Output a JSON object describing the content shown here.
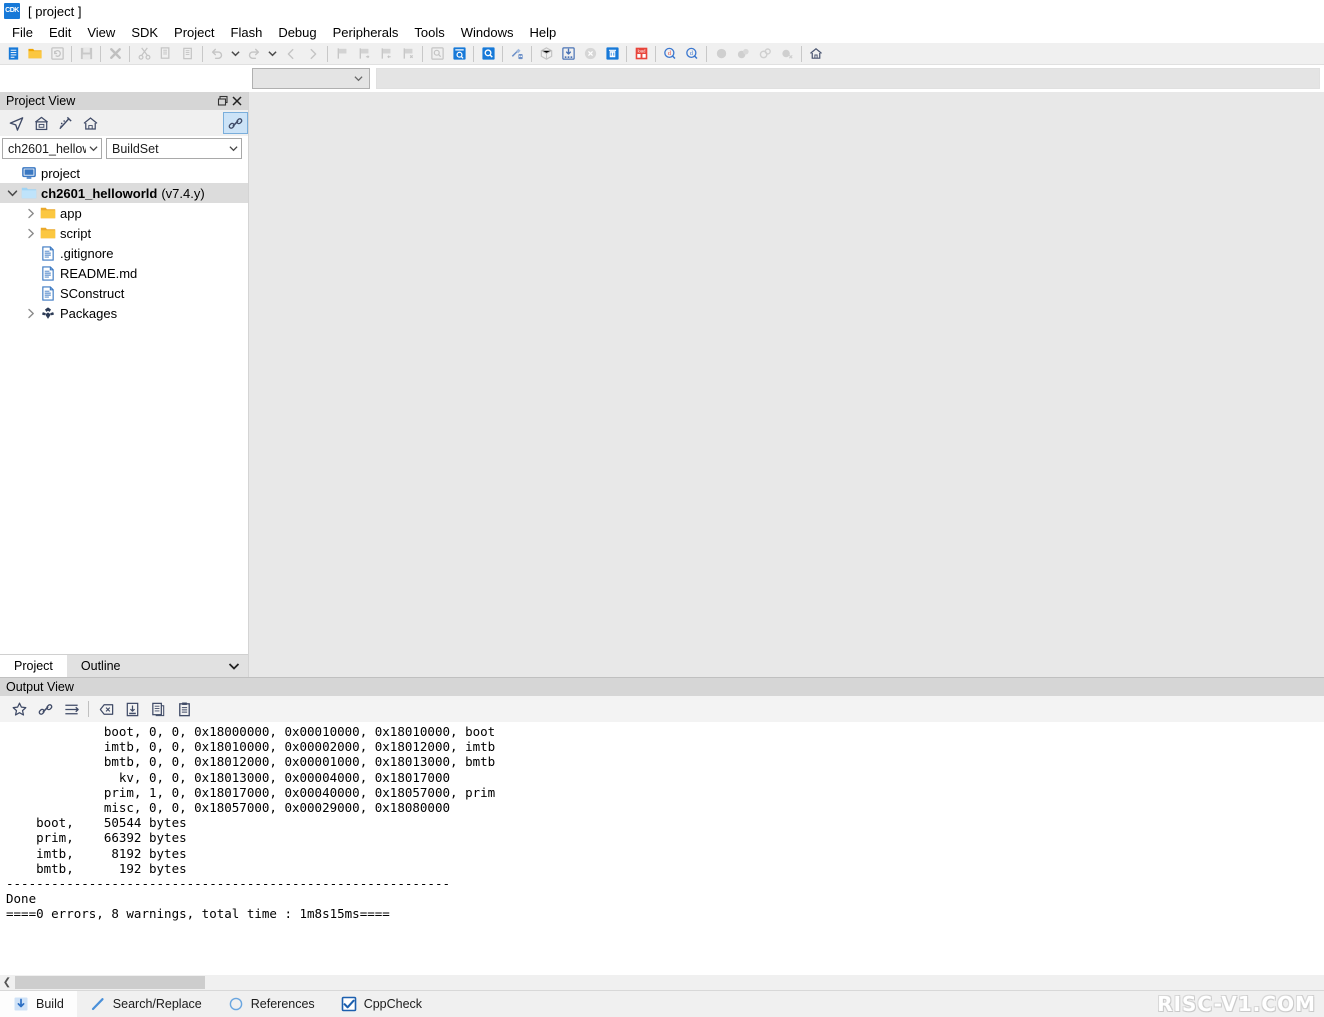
{
  "window": {
    "title": "[ project ]",
    "logo_text": "CDK"
  },
  "menubar": {
    "items": [
      {
        "label": "File"
      },
      {
        "label": "Edit"
      },
      {
        "label": "View"
      },
      {
        "label": "SDK"
      },
      {
        "label": "Project"
      },
      {
        "label": "Flash"
      },
      {
        "label": "Debug"
      },
      {
        "label": "Peripherals"
      },
      {
        "label": "Tools"
      },
      {
        "label": "Windows"
      },
      {
        "label": "Help"
      }
    ]
  },
  "toolbar": {
    "buttons": [
      {
        "name": "new-file-icon",
        "enabled": true
      },
      {
        "name": "open-folder-icon",
        "enabled": true
      },
      {
        "name": "refresh-icon",
        "enabled": false
      },
      {
        "name": "save-icon",
        "enabled": false
      },
      {
        "name": "close-all-icon",
        "enabled": false
      },
      {
        "name": "cut-icon",
        "enabled": false
      },
      {
        "name": "copy-icon",
        "enabled": false
      },
      {
        "name": "paste-icon",
        "enabled": false
      },
      {
        "name": "undo-icon",
        "enabled": false
      },
      {
        "name": "undo-dropdown-icon",
        "enabled": false
      },
      {
        "name": "redo-icon",
        "enabled": false
      },
      {
        "name": "redo-dropdown-icon",
        "enabled": false
      },
      {
        "name": "navigate-back-icon",
        "enabled": false
      },
      {
        "name": "navigate-forward-icon",
        "enabled": false
      },
      {
        "name": "bookmark-icon",
        "enabled": false
      },
      {
        "name": "bookmark-next-icon",
        "enabled": false
      },
      {
        "name": "bookmark-prev-icon",
        "enabled": false
      },
      {
        "name": "bookmark-clear-icon",
        "enabled": false
      },
      {
        "name": "find-icon",
        "enabled": false
      },
      {
        "name": "find-in-files-icon",
        "enabled": true
      },
      {
        "name": "search-icon",
        "enabled": true
      },
      {
        "name": "build-icon",
        "enabled": true
      },
      {
        "name": "package-icon",
        "enabled": false
      },
      {
        "name": "download-flash-icon",
        "enabled": true
      },
      {
        "name": "stop-build-icon",
        "enabled": false
      },
      {
        "name": "clean-icon",
        "enabled": true
      },
      {
        "name": "load-icon",
        "enabled": true
      },
      {
        "name": "debug-start-icon",
        "enabled": true
      },
      {
        "name": "debug-attach-icon",
        "enabled": true
      },
      {
        "name": "breakpoint-icon",
        "enabled": false
      },
      {
        "name": "breakpoint-all-icon",
        "enabled": false
      },
      {
        "name": "breakpoint-disable-icon",
        "enabled": false
      },
      {
        "name": "breakpoint-remove-icon",
        "enabled": false
      },
      {
        "name": "home-icon",
        "enabled": true
      }
    ]
  },
  "toolbar2": {
    "combo_value": "",
    "field_value": ""
  },
  "project_view": {
    "title": "Project View",
    "restore_label": "restore",
    "close_label": "close",
    "toolbar": [
      {
        "name": "locate-file-icon",
        "active": false
      },
      {
        "name": "collapse-all-icon",
        "active": false
      },
      {
        "name": "filter-icon",
        "active": false
      },
      {
        "name": "home-project-icon",
        "active": false
      },
      {
        "name": "link-editor-icon",
        "active": true
      }
    ],
    "project_combo": "ch2601_hellow",
    "buildset_combo": "BuildSet",
    "tree": [
      {
        "label": "project",
        "suffix": "",
        "depth": 0,
        "icon": "workspace-icon",
        "twisty": "none",
        "bold": false,
        "selected": false
      },
      {
        "label": "ch2601_helloworld",
        "suffix": "(v7.4.y)",
        "depth": 0,
        "icon": "project-folder-icon",
        "twisty": "expanded",
        "bold": true,
        "selected": true
      },
      {
        "label": "app",
        "suffix": "",
        "depth": 1,
        "icon": "folder-icon",
        "twisty": "collapsed",
        "bold": false,
        "selected": false
      },
      {
        "label": "script",
        "suffix": "",
        "depth": 1,
        "icon": "folder-icon",
        "twisty": "collapsed",
        "bold": false,
        "selected": false
      },
      {
        "label": ".gitignore",
        "suffix": "",
        "depth": 1,
        "icon": "file-icon",
        "twisty": "none",
        "bold": false,
        "selected": false
      },
      {
        "label": "README.md",
        "suffix": "",
        "depth": 1,
        "icon": "file-icon",
        "twisty": "none",
        "bold": false,
        "selected": false
      },
      {
        "label": "SConstruct",
        "suffix": "",
        "depth": 1,
        "icon": "file-icon",
        "twisty": "none",
        "bold": false,
        "selected": false
      },
      {
        "label": "Packages",
        "suffix": "",
        "depth": 1,
        "icon": "packages-icon",
        "twisty": "collapsed",
        "bold": false,
        "selected": false
      }
    ],
    "bottom_tabs": [
      {
        "label": "Project",
        "active": true
      },
      {
        "label": "Outline",
        "active": false
      }
    ]
  },
  "output_view": {
    "title": "Output View",
    "toolbar": [
      {
        "name": "favorite-icon"
      },
      {
        "name": "link-icon"
      },
      {
        "name": "wrap-lines-icon"
      },
      {
        "name": "clear-output-icon"
      },
      {
        "name": "save-output-icon"
      },
      {
        "name": "copy-output-icon"
      },
      {
        "name": "paste-output-icon"
      }
    ],
    "lines": [
      "             boot, 0, 0, 0x18000000, 0x00010000, 0x18010000, boot",
      "             imtb, 0, 0, 0x18010000, 0x00002000, 0x18012000, imtb",
      "             bmtb, 0, 0, 0x18012000, 0x00001000, 0x18013000, bmtb",
      "               kv, 0, 0, 0x18013000, 0x00004000, 0x18017000",
      "             prim, 1, 0, 0x18017000, 0x00040000, 0x18057000, prim",
      "             misc, 0, 0, 0x18057000, 0x00029000, 0x18080000",
      "    boot,    50544 bytes",
      "    prim,    66392 bytes",
      "    imtb,     8192 bytes",
      "    bmtb,      192 bytes",
      "-----------------------------------------------------------",
      "Done",
      "====0 errors, 8 warnings, total time : 1m8s15ms===="
    ]
  },
  "status_tabs": [
    {
      "label": "Build",
      "icon": "download-arrow-icon",
      "active": true
    },
    {
      "label": "Search/Replace",
      "icon": "pencil-icon",
      "active": false
    },
    {
      "label": "References",
      "icon": "circle-icon",
      "active": false
    },
    {
      "label": "CppCheck",
      "icon": "checkbox-icon",
      "active": false
    }
  ],
  "watermark": {
    "text": "RISC-V1.COM"
  },
  "colors": {
    "accent_blue": "#1779d8",
    "folder_yellow": "#f5c242",
    "selection_gray": "#dcdcdc",
    "panel_title_gray": "#d6d6d6",
    "toolbar_gray": "#f0f0f0",
    "icon_navy": "#3f4a66"
  }
}
